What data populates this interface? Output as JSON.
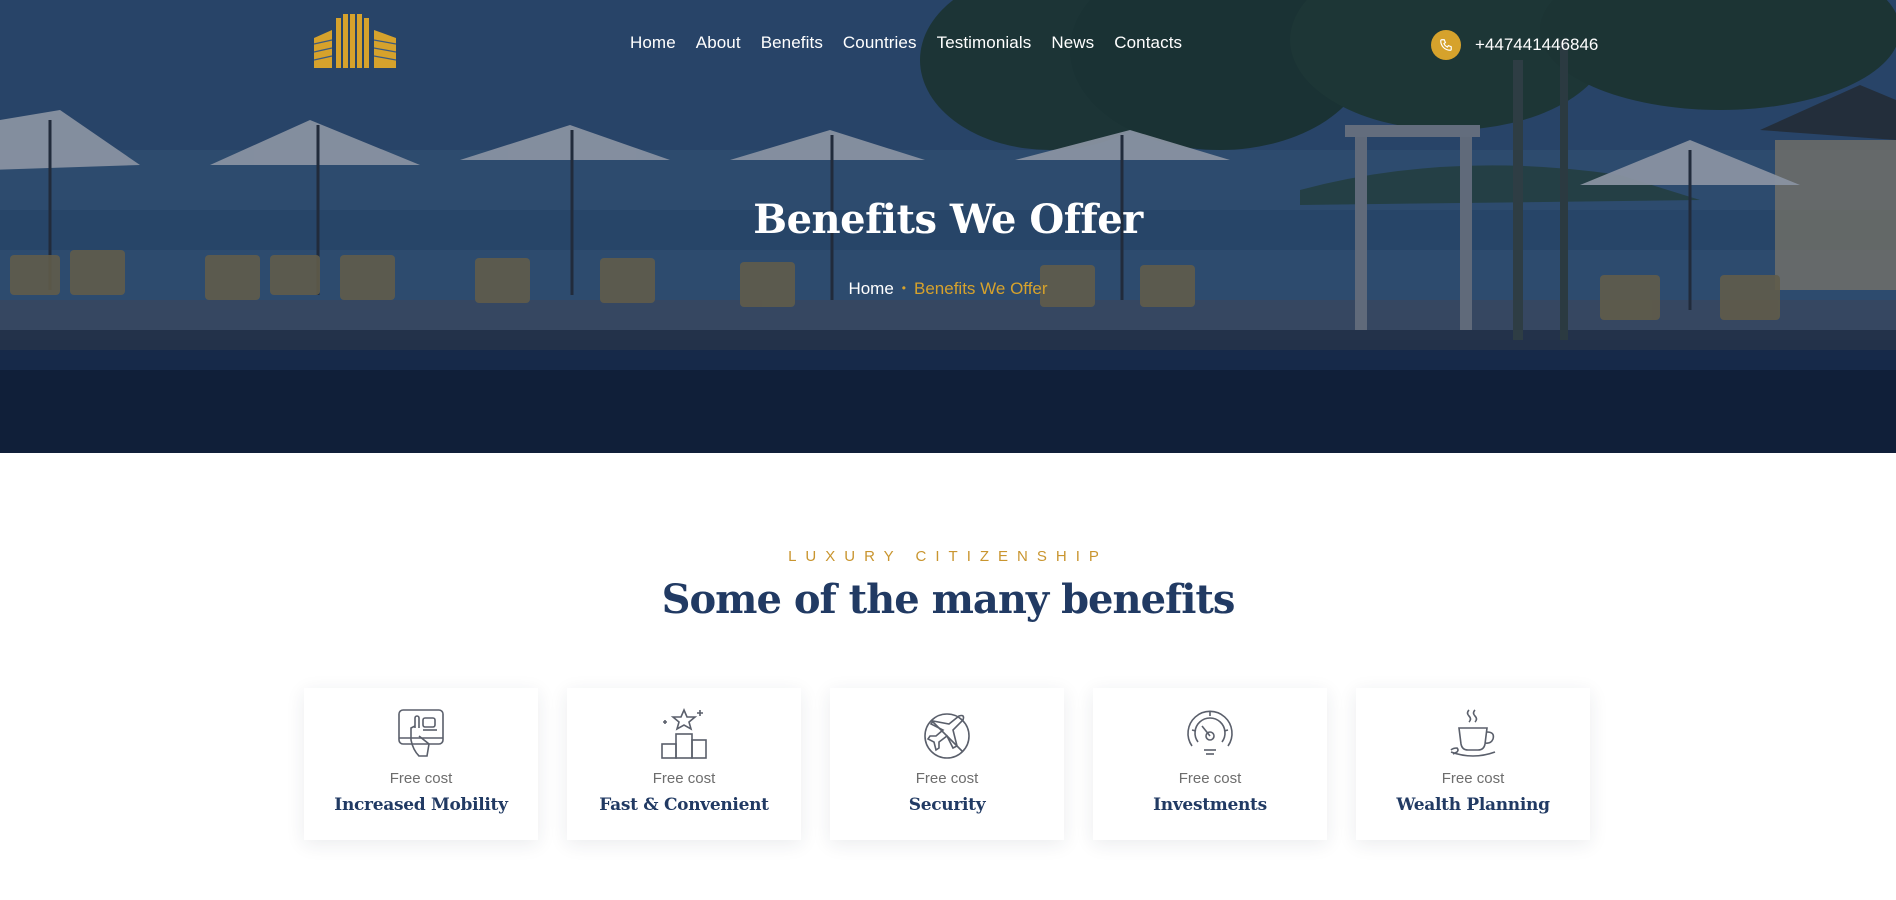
{
  "header": {
    "nav": [
      {
        "label": "Home"
      },
      {
        "label": "About"
      },
      {
        "label": "Benefits"
      },
      {
        "label": "Countries"
      },
      {
        "label": "Testimonials"
      },
      {
        "label": "News"
      },
      {
        "label": "Contacts"
      }
    ],
    "phone": "+447441446846",
    "phone_icon": "phone-icon",
    "logo_icon": "building-logo-icon"
  },
  "hero": {
    "title": "Benefits We Offer",
    "breadcrumb": {
      "home": "Home",
      "separator": "•",
      "current": "Benefits We Offer"
    },
    "background": "resort-pool-beach-photo"
  },
  "section": {
    "eyebrow": "LUXURY CITIZENSHIP",
    "title": "Some of the many benefits"
  },
  "cards": [
    {
      "icon": "tablet-touch-icon",
      "sub": "Free cost",
      "name": "Increased Mobility"
    },
    {
      "icon": "podium-star-icon",
      "sub": "Free cost",
      "name": "Fast & Convenient"
    },
    {
      "icon": "no-plane-security-icon",
      "sub": "Free cost",
      "name": "Security"
    },
    {
      "icon": "gauge-icon",
      "sub": "Free cost",
      "name": "Investments"
    },
    {
      "icon": "coffee-cup-icon",
      "sub": "Free cost",
      "name": "Wealth Planning"
    }
  ],
  "colors": {
    "accent": "#d6a22c",
    "heading": "#213a63",
    "eyebrow": "#c9952f",
    "muted": "#6d6d6d"
  }
}
